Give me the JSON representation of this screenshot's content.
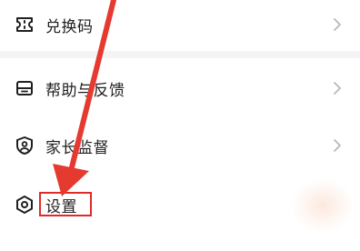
{
  "menu": {
    "items": [
      {
        "label": "兑换码",
        "icon": "ticket-icon"
      },
      {
        "label": "帮助与反馈",
        "icon": "feedback-icon"
      },
      {
        "label": "家长监督",
        "icon": "shield-user-icon"
      },
      {
        "label": "设置",
        "icon": "gear-icon"
      }
    ]
  },
  "annotations": {
    "arrow_color": "#e53a30",
    "highlight_color": "#e02a28"
  }
}
